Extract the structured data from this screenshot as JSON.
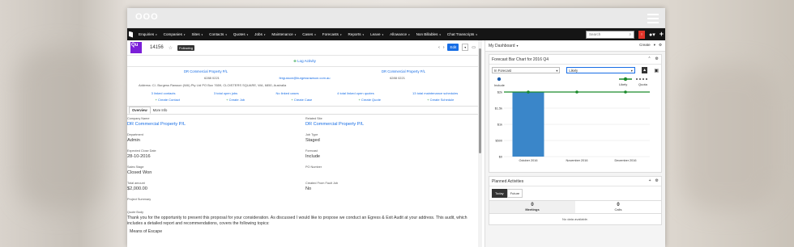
{
  "app": {
    "logo": "OOO"
  },
  "nav": {
    "items": [
      "Enquiries",
      "Companies",
      "Sites",
      "Contacts",
      "Quotes",
      "Jobs",
      "Maintenance",
      "Cases",
      "Forecasts",
      "Reports",
      "Leave",
      "Allowance",
      "Non Billables",
      "Chat Transcripts"
    ],
    "search_placeholder": "Search",
    "notif_count": "!"
  },
  "record": {
    "icon": "Qu",
    "number": "14156",
    "following": "Following",
    "edit": "Edit",
    "log_activity": "Log Activity",
    "company_left": "DR Commercial Property P/L",
    "company_right": "DR Commercial Property P/L",
    "phone_left": "6288 0221",
    "email": "fergusson@burgessrawson.com.au",
    "phone_right": "6288 0221",
    "address": "Address: C/- Burgess Rawson (WA) Pty Ltd PO Box 7659, CLOISTERS SQUARE, WA, 6850, Australia",
    "subpanels": [
      "3 linked contacts",
      "3 total open jobs",
      "No linked cases",
      "4 total linked open quotes",
      "13 total maintenance schedules"
    ],
    "create_links": [
      "Create Contact",
      "Create Job",
      "Create Case",
      "Create Quote",
      "Create Schedule"
    ],
    "tabs": [
      "Overview",
      "More Info"
    ]
  },
  "fields": {
    "company_name_lbl": "Company Name",
    "company_name": "DR Commercial Property P/L",
    "related_site_lbl": "Related Site",
    "related_site": "DR Commercial Property P/L",
    "department_lbl": "Department",
    "department": "Admin",
    "job_type_lbl": "Job Type",
    "job_type": "Staged",
    "close_date_lbl": "Expected Close Date",
    "close_date": "28-10-2016",
    "forecast_lbl": "Forecast",
    "forecast": "Include",
    "sales_stage_lbl": "Sales Stage",
    "sales_stage": "Closed Won",
    "po_number_lbl": "PO Number",
    "po_number": "",
    "total_lbl": "Total amount",
    "total": "$2,000.00",
    "created_lbl": "Created From Fault Job",
    "created": "No",
    "summary_lbl": "Project Summary",
    "quote_body_lbl": "Quote Body",
    "quote_body": "Thank you for the opportunity to present this proposal for your consideration. As discussed I would like to propose we conduct an Egress & Exit Audit at your address. This audit, which includes a detailed report and recommendations, covers the following topics:",
    "list_item": "Means of Escape"
  },
  "dashboard": {
    "title": "My Dashboard",
    "create": "Create",
    "forecast_title": "Forecast Bar Chart for 2016 Q4",
    "sel_left": "In Forecast",
    "sel_right": "Likely",
    "planned_title": "Planned Activities",
    "pa_tabs": [
      "Today",
      "Future"
    ],
    "meetings_count": "0",
    "meetings_lbl": "Meetings",
    "calls_count": "0",
    "calls_lbl": "Calls",
    "no_data": "No data available."
  },
  "chart_data": {
    "type": "bar",
    "categories": [
      "October 2016",
      "November 2016",
      "December 2016"
    ],
    "series": [
      {
        "name": "Closed",
        "values": [
          2000,
          0,
          0
        ]
      }
    ],
    "likely": [
      2000,
      2000,
      2000
    ],
    "legend_top": [
      "Include"
    ],
    "legend_right": [
      "Likely",
      "Quota"
    ],
    "yticks": [
      "$0",
      "$500",
      "$1k",
      "$1.5k",
      "$2k"
    ],
    "ylim": [
      0,
      2000
    ],
    "colors": {
      "bar": "#3a86c9",
      "likely": "#1a8a2a"
    }
  }
}
